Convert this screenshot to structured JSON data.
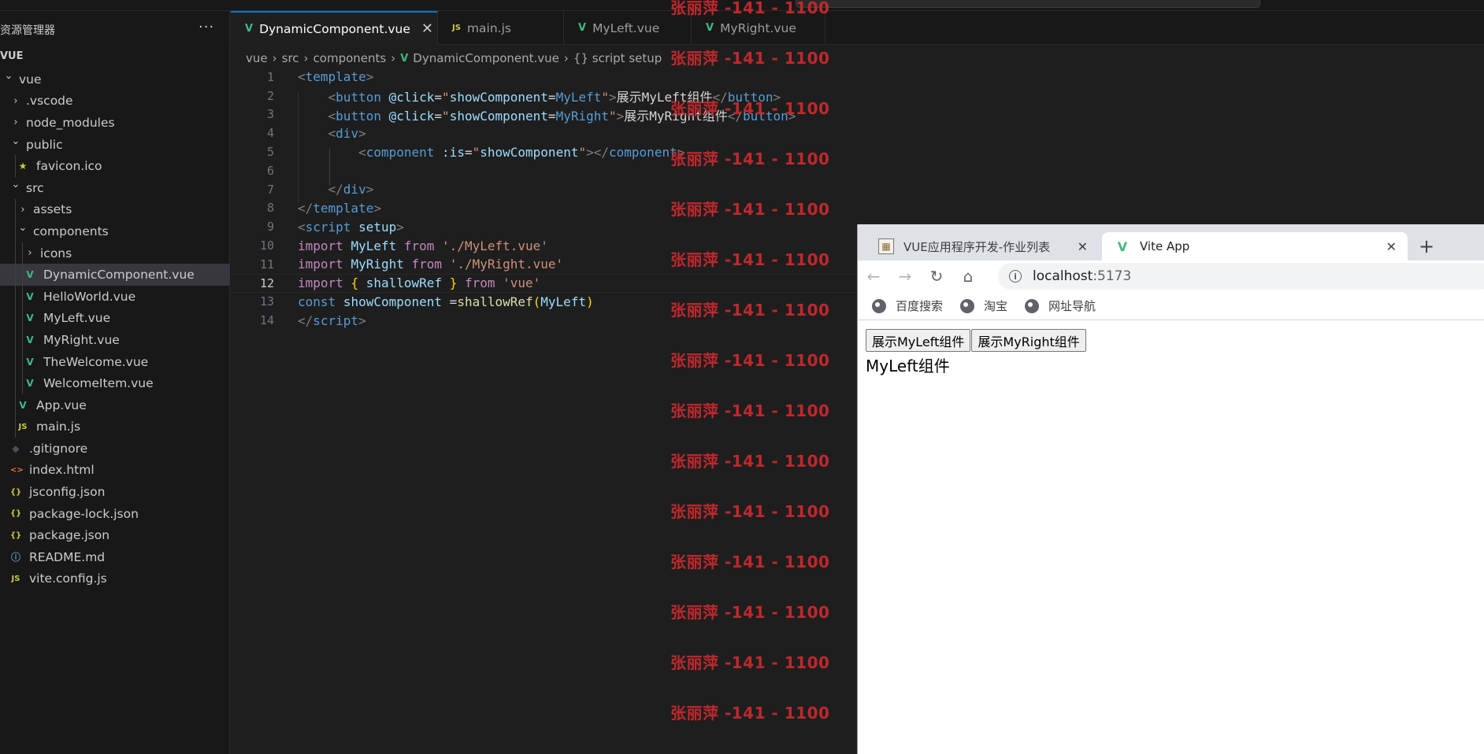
{
  "sidebar": {
    "title": "资源管理器",
    "more": "···",
    "root": "VUE",
    "items": [
      {
        "label": "vue",
        "depth": 0,
        "chevron": "down",
        "icon": ""
      },
      {
        "label": ".vscode",
        "depth": 1,
        "chevron": "right",
        "icon": ""
      },
      {
        "label": "node_modules",
        "depth": 1,
        "chevron": "right",
        "icon": ""
      },
      {
        "label": "public",
        "depth": 1,
        "chevron": "down",
        "icon": ""
      },
      {
        "label": "favicon.ico",
        "depth": 2,
        "chevron": "",
        "icon": "star"
      },
      {
        "label": "src",
        "depth": 1,
        "chevron": "down",
        "icon": ""
      },
      {
        "label": "assets",
        "depth": 2,
        "chevron": "right",
        "icon": ""
      },
      {
        "label": "components",
        "depth": 2,
        "chevron": "down",
        "icon": ""
      },
      {
        "label": "icons",
        "depth": 3,
        "chevron": "right",
        "icon": ""
      },
      {
        "label": "DynamicComponent.vue",
        "depth": 3,
        "chevron": "",
        "icon": "vue",
        "selected": true
      },
      {
        "label": "HelloWorld.vue",
        "depth": 3,
        "chevron": "",
        "icon": "vue"
      },
      {
        "label": "MyLeft.vue",
        "depth": 3,
        "chevron": "",
        "icon": "vue"
      },
      {
        "label": "MyRight.vue",
        "depth": 3,
        "chevron": "",
        "icon": "vue"
      },
      {
        "label": "TheWelcome.vue",
        "depth": 3,
        "chevron": "",
        "icon": "vue"
      },
      {
        "label": "WelcomeItem.vue",
        "depth": 3,
        "chevron": "",
        "icon": "vue"
      },
      {
        "label": "App.vue",
        "depth": 2,
        "chevron": "",
        "icon": "vue"
      },
      {
        "label": "main.js",
        "depth": 2,
        "chevron": "",
        "icon": "js"
      },
      {
        "label": ".gitignore",
        "depth": 1,
        "chevron": "",
        "icon": "git"
      },
      {
        "label": "index.html",
        "depth": 1,
        "chevron": "",
        "icon": "html"
      },
      {
        "label": "jsconfig.json",
        "depth": 1,
        "chevron": "",
        "icon": "json"
      },
      {
        "label": "package-lock.json",
        "depth": 1,
        "chevron": "",
        "icon": "json"
      },
      {
        "label": "package.json",
        "depth": 1,
        "chevron": "",
        "icon": "json"
      },
      {
        "label": "README.md",
        "depth": 1,
        "chevron": "",
        "icon": "info"
      },
      {
        "label": "vite.config.js",
        "depth": 1,
        "chevron": "",
        "icon": "js"
      }
    ]
  },
  "tabs": [
    {
      "label": "DynamicComponent.vue",
      "icon": "vue",
      "active": true
    },
    {
      "label": "main.js",
      "icon": "js",
      "active": false
    },
    {
      "label": "MyLeft.vue",
      "icon": "vue",
      "active": false
    },
    {
      "label": "MyRight.vue",
      "icon": "vue",
      "active": false
    }
  ],
  "breadcrumbs": [
    "vue",
    "src",
    "components",
    "DynamicComponent.vue",
    "{} script setup"
  ],
  "code": {
    "current_line": 12,
    "lines": [
      [
        [
          "br",
          "<"
        ],
        [
          "tag",
          "template"
        ],
        [
          "br",
          ">"
        ]
      ],
      [
        [
          "plain",
          "    "
        ],
        [
          "br",
          "<"
        ],
        [
          "tag",
          "button"
        ],
        [
          "plain",
          " "
        ],
        [
          "attr",
          "@click"
        ],
        [
          "plain",
          "="
        ],
        [
          "str",
          "\""
        ],
        [
          "attr",
          "showComponent"
        ],
        [
          "plain",
          "="
        ],
        [
          "kw2",
          "MyLeft"
        ],
        [
          "str",
          "\""
        ],
        [
          "br",
          ">"
        ],
        [
          "plain",
          "展示MyLeft组件"
        ],
        [
          "br",
          "</"
        ],
        [
          "tag",
          "button"
        ],
        [
          "br",
          ">"
        ]
      ],
      [
        [
          "plain",
          "    "
        ],
        [
          "br",
          "<"
        ],
        [
          "tag",
          "button"
        ],
        [
          "plain",
          " "
        ],
        [
          "attr",
          "@click"
        ],
        [
          "plain",
          "="
        ],
        [
          "str",
          "\""
        ],
        [
          "attr",
          "showComponent"
        ],
        [
          "plain",
          "="
        ],
        [
          "kw2",
          "MyRight"
        ],
        [
          "str",
          "\""
        ],
        [
          "br",
          ">"
        ],
        [
          "plain",
          "展示MyRight组件"
        ],
        [
          "br",
          "</"
        ],
        [
          "tag",
          "button"
        ],
        [
          "br",
          ">"
        ]
      ],
      [
        [
          "plain",
          "    "
        ],
        [
          "br",
          "<"
        ],
        [
          "tag",
          "div"
        ],
        [
          "br",
          ">"
        ]
      ],
      [
        [
          "plain",
          "        "
        ],
        [
          "br",
          "<"
        ],
        [
          "tag",
          "component"
        ],
        [
          "plain",
          " "
        ],
        [
          "attr",
          ":is"
        ],
        [
          "plain",
          "="
        ],
        [
          "str",
          "\""
        ],
        [
          "attr",
          "showComponent"
        ],
        [
          "str",
          "\""
        ],
        [
          "br",
          "></"
        ],
        [
          "tag",
          "component"
        ],
        [
          "br",
          ">"
        ]
      ],
      [
        [
          "plain",
          " "
        ]
      ],
      [
        [
          "plain",
          "    "
        ],
        [
          "br",
          "</"
        ],
        [
          "tag",
          "div"
        ],
        [
          "br",
          ">"
        ]
      ],
      [
        [
          "br",
          "</"
        ],
        [
          "tag",
          "template"
        ],
        [
          "br",
          ">"
        ]
      ],
      [
        [
          "br",
          "<"
        ],
        [
          "tag",
          "script"
        ],
        [
          "plain",
          " "
        ],
        [
          "attr",
          "setup"
        ],
        [
          "br",
          ">"
        ]
      ],
      [
        [
          "kw",
          "import"
        ],
        [
          "plain",
          " "
        ],
        [
          "var",
          "MyLeft"
        ],
        [
          "plain",
          " "
        ],
        [
          "kw",
          "from"
        ],
        [
          "plain",
          " "
        ],
        [
          "str",
          "'./MyLeft.vue'"
        ]
      ],
      [
        [
          "kw",
          "import"
        ],
        [
          "plain",
          " "
        ],
        [
          "var",
          "MyRight"
        ],
        [
          "plain",
          " "
        ],
        [
          "kw",
          "from"
        ],
        [
          "plain",
          " "
        ],
        [
          "str",
          "'./MyRight.vue'"
        ]
      ],
      [
        [
          "kw",
          "import"
        ],
        [
          "plain",
          " "
        ],
        [
          "brace",
          "{"
        ],
        [
          "plain",
          " "
        ],
        [
          "var",
          "shallowRef"
        ],
        [
          "plain",
          " "
        ],
        [
          "brace",
          "}"
        ],
        [
          "plain",
          " "
        ],
        [
          "kw",
          "from"
        ],
        [
          "plain",
          " "
        ],
        [
          "str",
          "'vue'"
        ]
      ],
      [
        [
          "kw2",
          "const"
        ],
        [
          "plain",
          " "
        ],
        [
          "var",
          "showComponent"
        ],
        [
          "plain",
          " ="
        ],
        [
          "fn",
          "shallowRef"
        ],
        [
          "brace",
          "("
        ],
        [
          "var",
          "MyLeft"
        ],
        [
          "brace",
          ")"
        ]
      ],
      [
        [
          "br",
          "</"
        ],
        [
          "tag",
          "script"
        ],
        [
          "br",
          ">"
        ]
      ]
    ]
  },
  "watermark": {
    "text": "张丽萍 -141 - 1100",
    "count": 15
  },
  "browser": {
    "tabs": [
      {
        "label": "VUE应用程序开发-作业列表",
        "active": false
      },
      {
        "label": "Vite App",
        "active": true
      }
    ],
    "new_tab": "+",
    "url_host": "localhost",
    "url_port": ":5173",
    "bookmarks": [
      "百度搜索",
      "淘宝",
      "网址导航"
    ],
    "page": {
      "buttons": [
        "展示MyLeft组件",
        "展示MyRight组件"
      ],
      "component_text": "MyLeft组件"
    }
  },
  "colors": {
    "accent": "#0078d4",
    "vue_green": "#41b883",
    "watermark_red": "#c0282d"
  }
}
